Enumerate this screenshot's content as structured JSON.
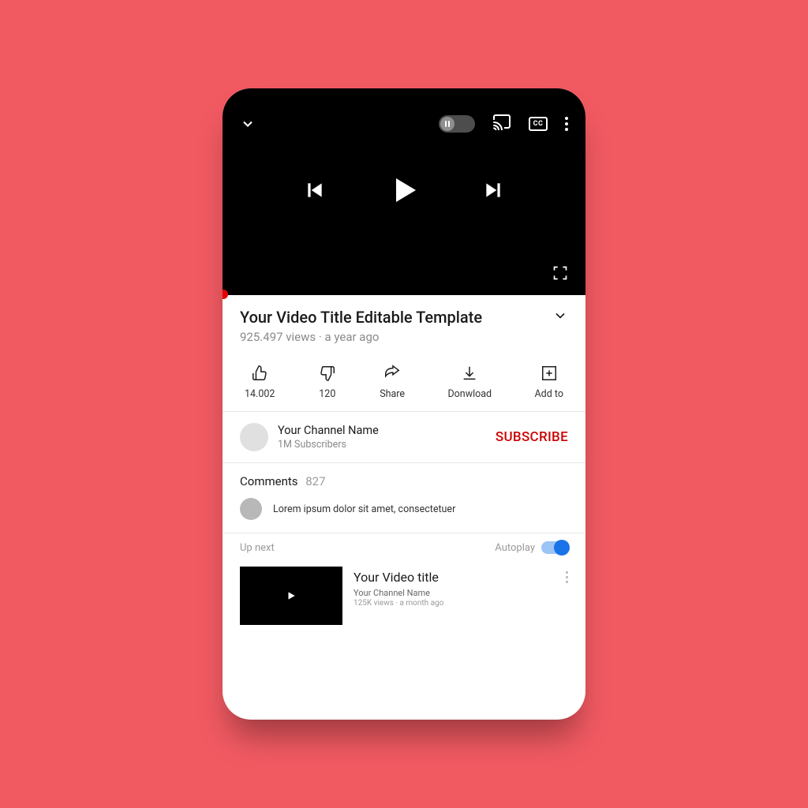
{
  "video": {
    "title": "Your Video Title Editable Template",
    "views_and_age": "925.497 views · a year ago"
  },
  "actions": {
    "likes": "14.002",
    "dislikes": "120",
    "share": "Share",
    "download": "Donwload",
    "add_to": "Add to"
  },
  "channel": {
    "name": "Your Channel Name",
    "subs": "1M Subscribers",
    "subscribe_label": "SUBSCRIBE"
  },
  "comments": {
    "label": "Comments",
    "count": "827",
    "sample": "Lorem ipsum dolor sit amet, consectetuer"
  },
  "upnext": {
    "label": "Up next",
    "autoplay_label": "Autoplay",
    "item": {
      "title": "Your Video title",
      "channel": "Your Channel Name",
      "meta": "125K views · a month ago"
    }
  }
}
